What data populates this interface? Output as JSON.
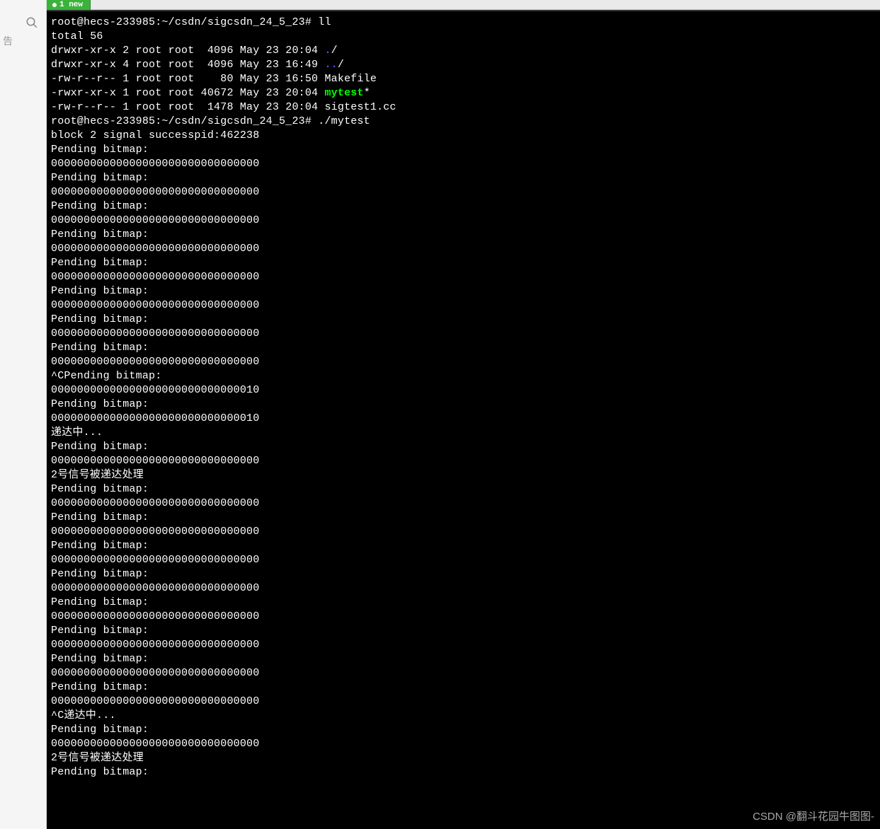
{
  "tab": {
    "label": "1 new"
  },
  "watermark": "CSDN @翻斗花园牛图图-",
  "colors": {
    "exec_green": "#00ff00",
    "dir_blue": "#5555ff",
    "bg": "#000000",
    "fg": "#ffffff"
  },
  "terminal": {
    "prompt1": {
      "user_host_path": "root@hecs-233985:~/csdn/sigcsdn_24_5_23#",
      "cmd": "ll"
    },
    "ll_output": {
      "total": "total 56",
      "rows": [
        {
          "perm": "drwxr-xr-x 2 root root  4096 May 23 20:04 ",
          "name": ".",
          "suffix": "/",
          "class": "dir-blue"
        },
        {
          "perm": "drwxr-xr-x 4 root root  4096 May 23 16:49 ",
          "name": "..",
          "suffix": "/",
          "class": "dir-blue"
        },
        {
          "perm": "-rw-r--r-- 1 root root    80 May 23 16:50 ",
          "name": "Makefile",
          "suffix": "",
          "class": ""
        },
        {
          "perm": "-rwxr-xr-x 1 root root 40672 May 23 20:04 ",
          "name": "mytest",
          "suffix": "*",
          "class": "exec-green"
        },
        {
          "perm": "-rw-r--r-- 1 root root  1478 May 23 20:04 ",
          "name": "sigtest1.cc",
          "suffix": "",
          "class": ""
        }
      ]
    },
    "prompt2": {
      "user_host_path": "root@hecs-233985:~/csdn/sigcsdn_24_5_23#",
      "cmd": "./mytest"
    },
    "output_lines": [
      "block 2 signal successpid:462238",
      "Pending bitmap:",
      "00000000000000000000000000000000",
      "Pending bitmap:",
      "00000000000000000000000000000000",
      "Pending bitmap:",
      "00000000000000000000000000000000",
      "Pending bitmap:",
      "00000000000000000000000000000000",
      "Pending bitmap:",
      "00000000000000000000000000000000",
      "Pending bitmap:",
      "00000000000000000000000000000000",
      "Pending bitmap:",
      "00000000000000000000000000000000",
      "Pending bitmap:",
      "00000000000000000000000000000000",
      "^CPending bitmap:",
      "00000000000000000000000000000010",
      "Pending bitmap:",
      "00000000000000000000000000000010",
      "递达中...",
      "Pending bitmap:",
      "00000000000000000000000000000000",
      "2号信号被递达处理",
      "Pending bitmap:",
      "00000000000000000000000000000000",
      "Pending bitmap:",
      "00000000000000000000000000000000",
      "Pending bitmap:",
      "00000000000000000000000000000000",
      "Pending bitmap:",
      "00000000000000000000000000000000",
      "Pending bitmap:",
      "00000000000000000000000000000000",
      "Pending bitmap:",
      "00000000000000000000000000000000",
      "Pending bitmap:",
      "00000000000000000000000000000000",
      "Pending bitmap:",
      "00000000000000000000000000000000",
      "^C递达中...",
      "Pending bitmap:",
      "00000000000000000000000000000000",
      "2号信号被递达处理",
      "Pending bitmap:"
    ]
  }
}
